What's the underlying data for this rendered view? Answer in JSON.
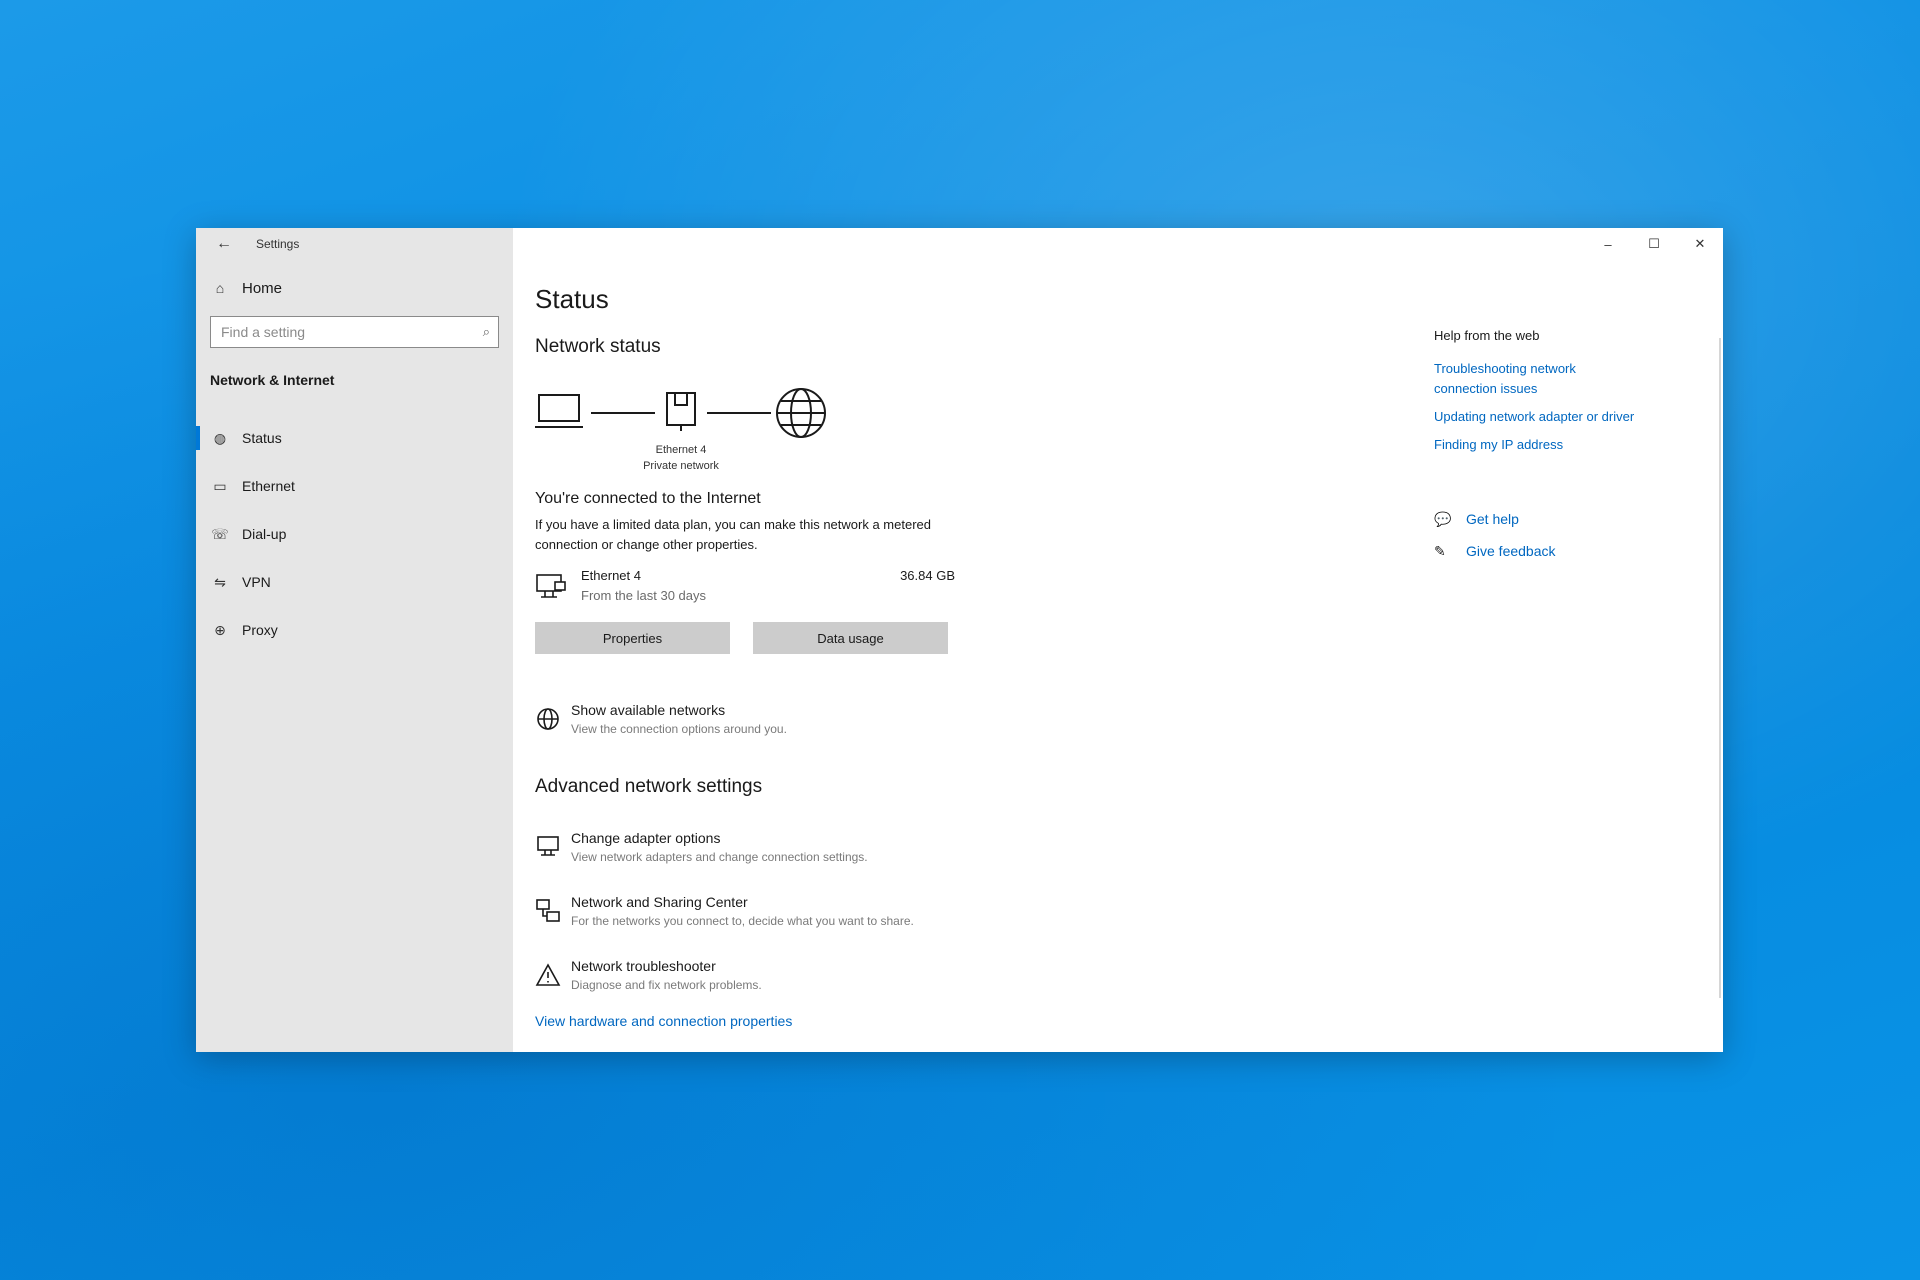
{
  "window": {
    "app_title": "Settings",
    "controls": {
      "minimize": "–",
      "maximize": "☐",
      "close": "✕"
    }
  },
  "sidebar": {
    "home_label": "Home",
    "search_placeholder": "Find a setting",
    "section_title": "Network & Internet",
    "items": [
      {
        "label": "Status",
        "icon": "status-globe-icon",
        "active": true
      },
      {
        "label": "Ethernet",
        "icon": "ethernet-icon",
        "active": false
      },
      {
        "label": "Dial-up",
        "icon": "dial-up-icon",
        "active": false
      },
      {
        "label": "VPN",
        "icon": "vpn-icon",
        "active": false
      },
      {
        "label": "Proxy",
        "icon": "proxy-globe-icon",
        "active": false
      }
    ]
  },
  "main": {
    "title": "Status",
    "network_status_title": "Network status",
    "diagram": {
      "adapter_name": "Ethernet 4",
      "network_type": "Private network"
    },
    "connected_title": "You're connected to the Internet",
    "connected_desc": "If you have a limited data plan, you can make this network a metered connection or change other properties.",
    "adapter": {
      "name": "Ethernet 4",
      "period": "From the last 30 days",
      "usage": "36.84 GB"
    },
    "buttons": {
      "properties": "Properties",
      "data_usage": "Data usage"
    },
    "show_networks": {
      "title": "Show available networks",
      "desc": "View the connection options around you."
    },
    "advanced_title": "Advanced network settings",
    "advanced_items": [
      {
        "title": "Change adapter options",
        "desc": "View network adapters and change connection settings."
      },
      {
        "title": "Network and Sharing Center",
        "desc": "For the networks you connect to, decide what you want to share."
      },
      {
        "title": "Network troubleshooter",
        "desc": "Diagnose and fix network problems."
      }
    ],
    "hardware_link": "View hardware and connection properties"
  },
  "help": {
    "title": "Help from the web",
    "links": [
      "Troubleshooting network connection issues",
      "Updating network adapter or driver",
      "Finding my IP address"
    ],
    "get_help": "Get help",
    "give_feedback": "Give feedback"
  },
  "colors": {
    "accent": "#0078d7",
    "link": "#0067c0",
    "sidebar_bg": "#e6e6e6",
    "desktop": "#0a8fe4"
  }
}
